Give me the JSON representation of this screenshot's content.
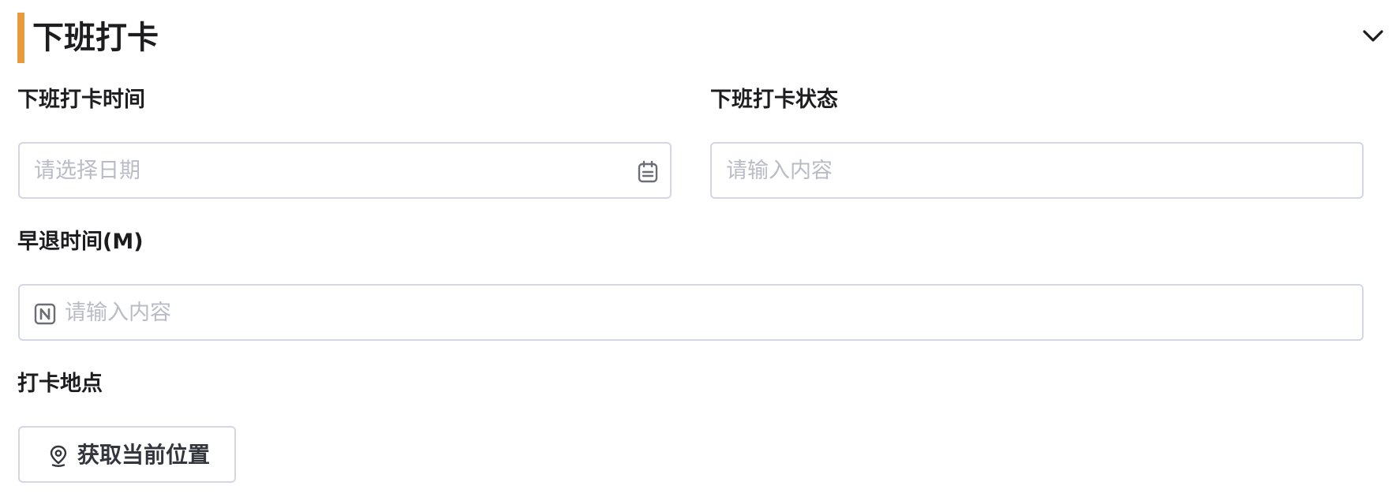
{
  "section": {
    "title": "下班打卡",
    "accent_color": "#e99b3b",
    "collapse_icon": "chevron-down-icon"
  },
  "fields": {
    "clockout_time": {
      "label": "下班打卡时间",
      "placeholder": "请选择日期",
      "value": "",
      "icon": "calendar-icon"
    },
    "clockout_status": {
      "label": "下班打卡状态",
      "placeholder": "请输入内容",
      "value": ""
    },
    "early_leave": {
      "label": "早退时间(M)",
      "placeholder": "请输入内容",
      "value": "",
      "icon": "number-icon"
    },
    "location": {
      "label": "打卡地点",
      "button_label": "获取当前位置",
      "icon": "location-pin-icon"
    }
  }
}
